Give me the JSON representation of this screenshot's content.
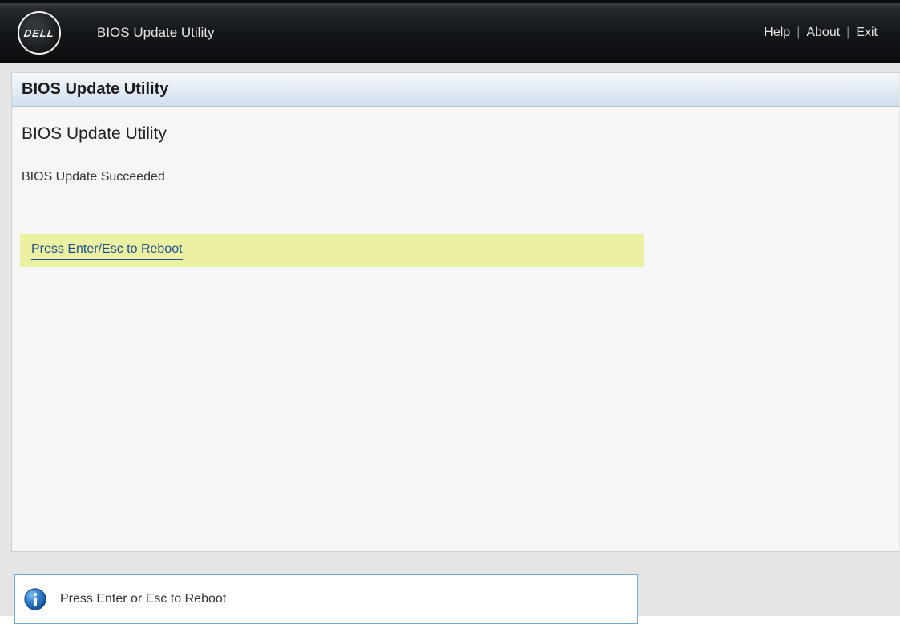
{
  "header": {
    "logo_text": "DELL",
    "app_title": "BIOS Update Utility",
    "links": {
      "help": "Help",
      "about": "About",
      "exit": "Exit"
    }
  },
  "panel": {
    "title": "BIOS Update Utility",
    "subtitle": "BIOS Update Utility",
    "status": "BIOS Update Succeeded",
    "action": "Press Enter/Esc to Reboot"
  },
  "footer": {
    "message": "Press Enter or Esc to Reboot"
  }
}
